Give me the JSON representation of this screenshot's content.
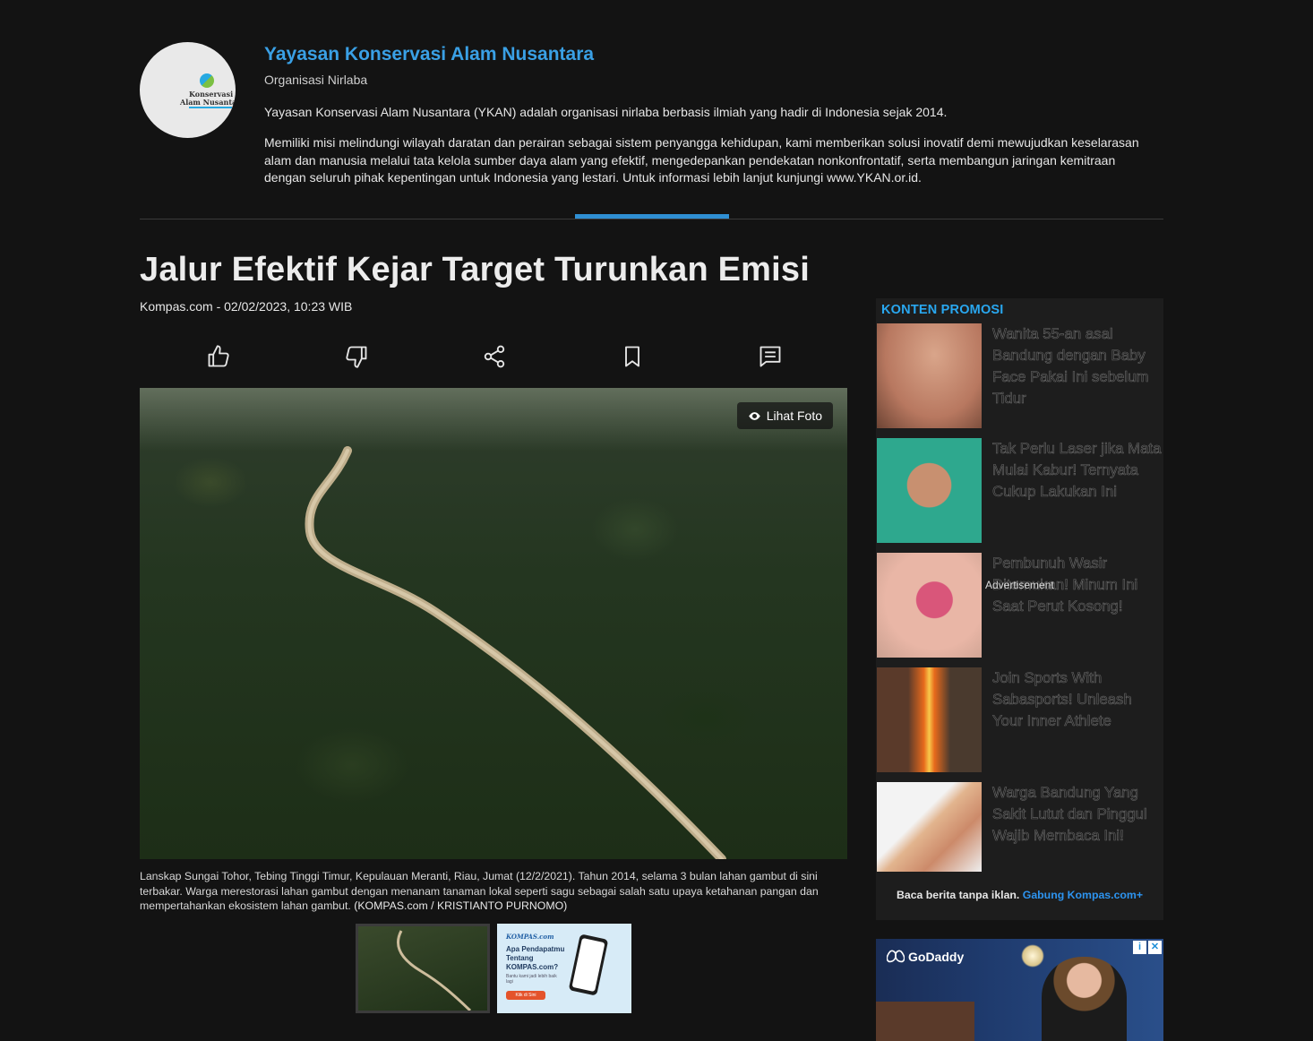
{
  "org": {
    "logo_line1": "Konservasi",
    "logo_line2": "Alam Nusantara",
    "name": "Yayasan Konservasi Alam Nusantara",
    "type": "Organisasi Nirlaba",
    "p1": "Yayasan Konservasi Alam Nusantara (YKAN) adalah organisasi nirlaba berbasis ilmiah yang hadir di Indonesia sejak 2014.",
    "p2": "Memiliki misi melindungi wilayah daratan dan perairan sebagai sistem penyangga kehidupan, kami memberikan solusi inovatif demi mewujudkan keselarasan alam dan manusia melalui tata kelola sumber daya alam yang efektif, mengedepankan pendekatan nonkonfrontatif, serta membangun jaringan kemitraan dengan seluruh pihak kepentingan untuk Indonesia yang lestari. Untuk informasi lebih lanjut kunjungi www.YKAN.or.id."
  },
  "article": {
    "title": "Jalur Efektif Kejar Target Turunkan Emisi",
    "meta": "Kompas.com - 02/02/2023, 10:23 WIB",
    "lihat_foto": "Lihat Foto",
    "caption": "Lanskap Sungai Tohor, Tebing Tinggi Timur, Kepulauan Meranti, Riau, Jumat (12/2/2021). Tahun 2014, selama 3 bulan lahan gambut di sini terbakar. Warga merestorasi lahan gambut dengan menanam tanaman lokal seperti sagu sebagai salah satu upaya ketahanan pangan dan mempertahankan ekosistem lahan gambut.",
    "credit": "(KOMPAS.com / KRISTIANTO PURNOMO)"
  },
  "thumb_ad": {
    "brand": "KOMPAS.com",
    "question": "Apa Pendapatmu Tentang KOMPAS.com?",
    "sub": "Bantu kami jadi lebih baik lagi",
    "button": "Klik di Sini"
  },
  "promo": {
    "heading": "KONTEN PROMOSI",
    "advertisement_label": "Advertisement",
    "items": [
      {
        "text": "Wanita 55-an asal Bandung dengan Baby Face Pakai Ini sebelum Tidur"
      },
      {
        "text": "Tak Perlu Laser jika Mata Mulai Kabur! Ternyata Cukup Lakukan Ini"
      },
      {
        "text": "Pembunuh Wasir Ditemukan! Minum Ini Saat Perut Kosong!"
      },
      {
        "text": "Join Sports With Sabasports! Unleash Your Inner Athlete"
      },
      {
        "text": "Warga Bandung Yang Sakit Lutut dan Pinggul Wajib Membaca Ini!"
      }
    ],
    "footer_text": "Baca berita tanpa iklan.",
    "footer_link": "Gabung Kompas.com+"
  },
  "ad": {
    "brand": "GoDaddy",
    "info": "i",
    "close": "✕"
  },
  "colors": {
    "background": "#131313",
    "accent_blue": "#3aa0e5",
    "promo_heading": "#29a7ef",
    "link_blue": "#2d94f0"
  }
}
